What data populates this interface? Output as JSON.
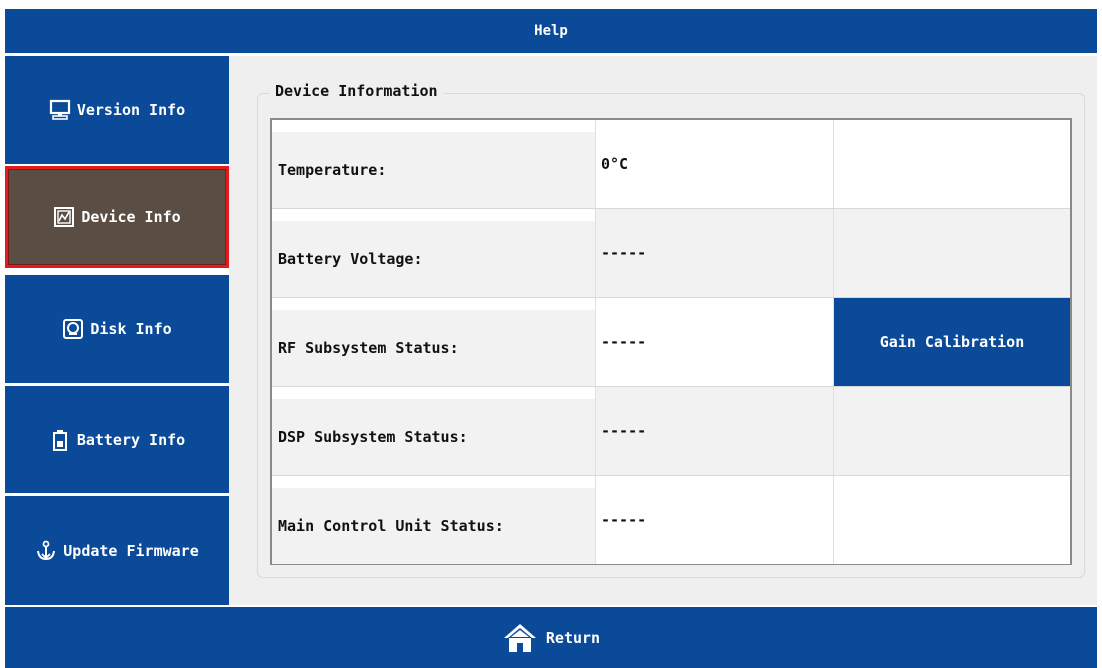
{
  "title": "Help",
  "sidebar": {
    "items": [
      {
        "label": "Version Info",
        "icon": "monitor-icon",
        "active": false
      },
      {
        "label": "Device Info",
        "icon": "device-chart-icon",
        "active": true
      },
      {
        "label": "Disk Info",
        "icon": "disk-icon",
        "active": false
      },
      {
        "label": "Battery Info",
        "icon": "battery-icon",
        "active": false
      },
      {
        "label": "Update Firmware",
        "icon": "update-icon",
        "active": false
      }
    ]
  },
  "main": {
    "section_title": "Device Information",
    "rows": [
      {
        "label": "Temperature:",
        "value": "0°C",
        "extra": ""
      },
      {
        "label": "Battery Voltage:",
        "value": "-----",
        "extra": ""
      },
      {
        "label": "RF Subsystem Status:",
        "value": "-----",
        "extra": "Gain Calibration"
      },
      {
        "label": "DSP Subsystem Status:",
        "value": "-----",
        "extra": ""
      },
      {
        "label": "Main Control Unit Status:",
        "value": "-----",
        "extra": ""
      }
    ]
  },
  "footer": {
    "return_label": "Return",
    "icon": "home-icon"
  },
  "colors": {
    "primary_blue": "#0a4a98",
    "active_bg": "#5a4e44",
    "active_border": "#e01c1c"
  }
}
